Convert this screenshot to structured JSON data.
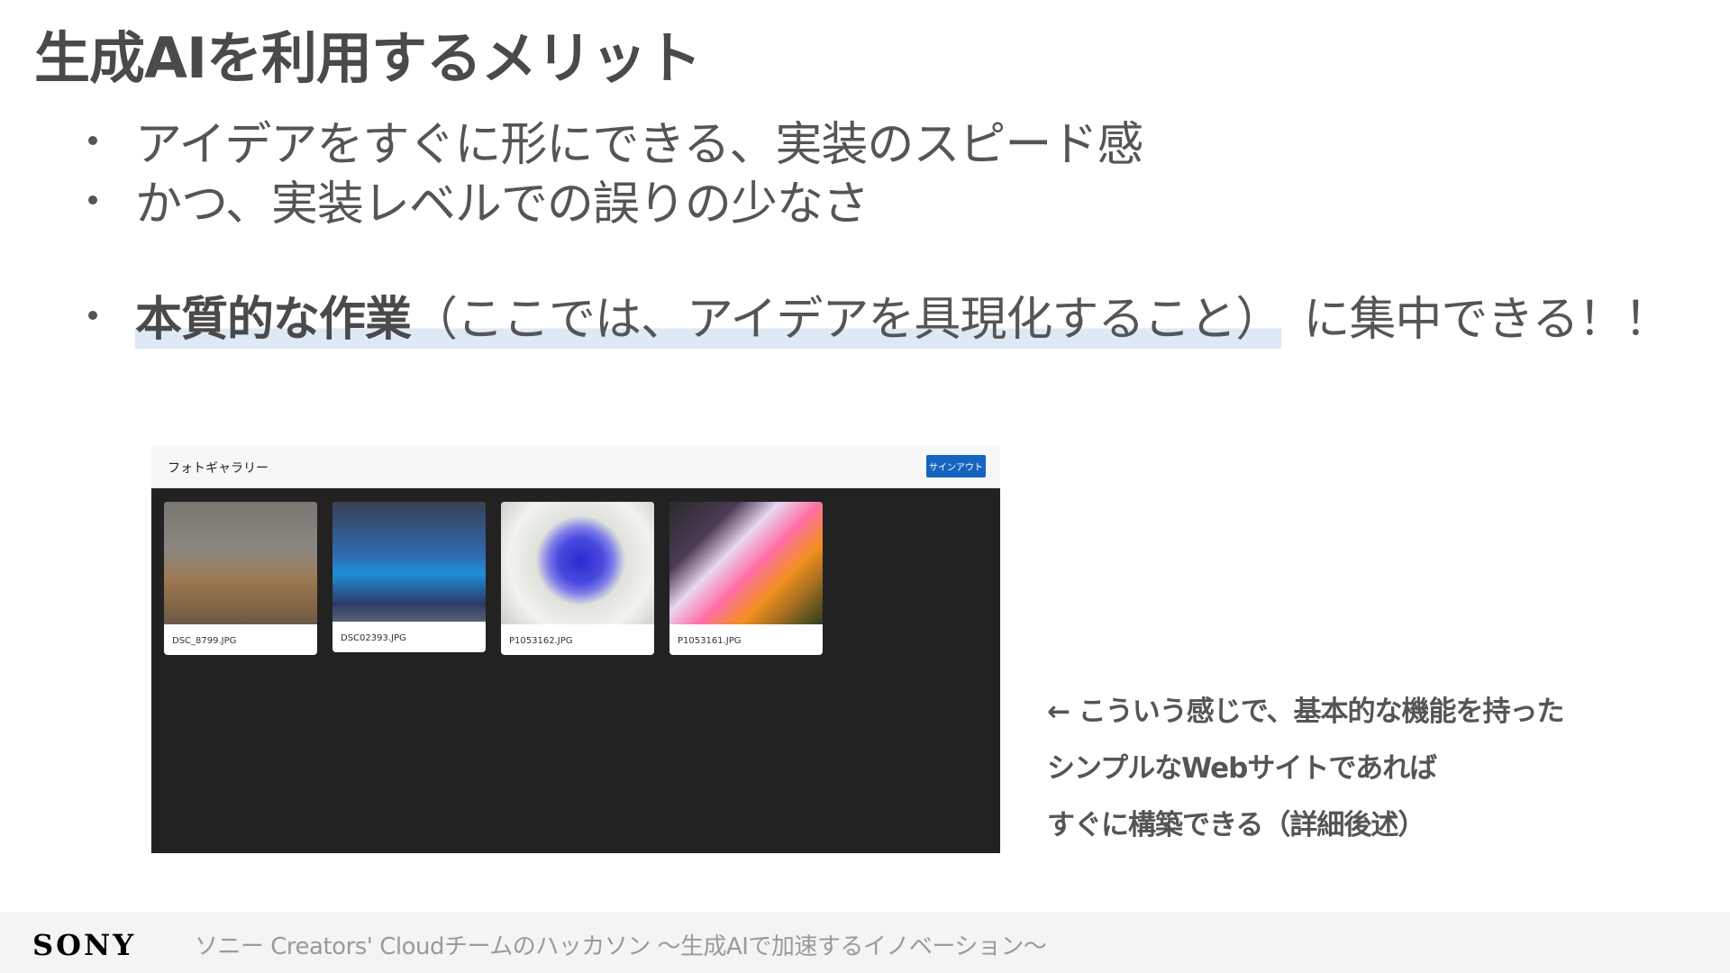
{
  "slide": {
    "title": "生成AIを利用するメリット",
    "bullets": [
      "アイデアをすぐに形にできる、実装のスピード感",
      "かつ、実装レベルでの誤りの少なさ"
    ],
    "bullet3": {
      "bold": "本質的な作業",
      "paren": "（ここでは、アイデアを具現化すること）",
      "rest": "に集中できる！！"
    }
  },
  "screenshot": {
    "app_title": "フォトギャラリー",
    "signout_label": "サインアウト",
    "photos": [
      {
        "filename": "DSC_8799.JPG"
      },
      {
        "filename": "DSC02393.JPG"
      },
      {
        "filename": "P1053162.JPG"
      },
      {
        "filename": "P1053161.JPG"
      }
    ]
  },
  "note": {
    "lines": [
      "← こういう感じで、基本的な機能を持った",
      "シンプルなWebサイトであれば",
      "すぐに構築できる（詳細後述）"
    ]
  },
  "footer": {
    "logo": "SONY",
    "text": "ソニー Creators' Cloudチームのハッカソン ～生成AIで加速するイノベーション～"
  }
}
